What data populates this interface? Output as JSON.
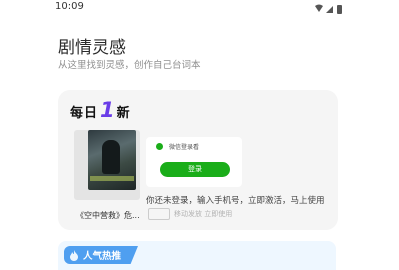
{
  "status_bar": {
    "time": "10:09",
    "icons": [
      "wifi-icon",
      "cellular-signal-icon",
      "battery-icon"
    ]
  },
  "header": {
    "title": "剧情灵感",
    "subtitle": "从这里找到灵感，创作自己台词本"
  },
  "daily_card": {
    "title_prefix": "每日",
    "title_number": "1",
    "title_suffix": "新",
    "movie_name": "《空中营救》危...",
    "login_hint": "微信登录看",
    "login_button": "登录",
    "lyric_line": "你还未登录，输入手机号，立即激活，马上使用",
    "lyric_line2": "移动发放 立即使用"
  },
  "hot_section": {
    "label": "人气热推"
  },
  "colors": {
    "accent_purple": "#6a3de8",
    "wechat_green": "#1aad19",
    "hot_blue": "#4f9ff0"
  }
}
